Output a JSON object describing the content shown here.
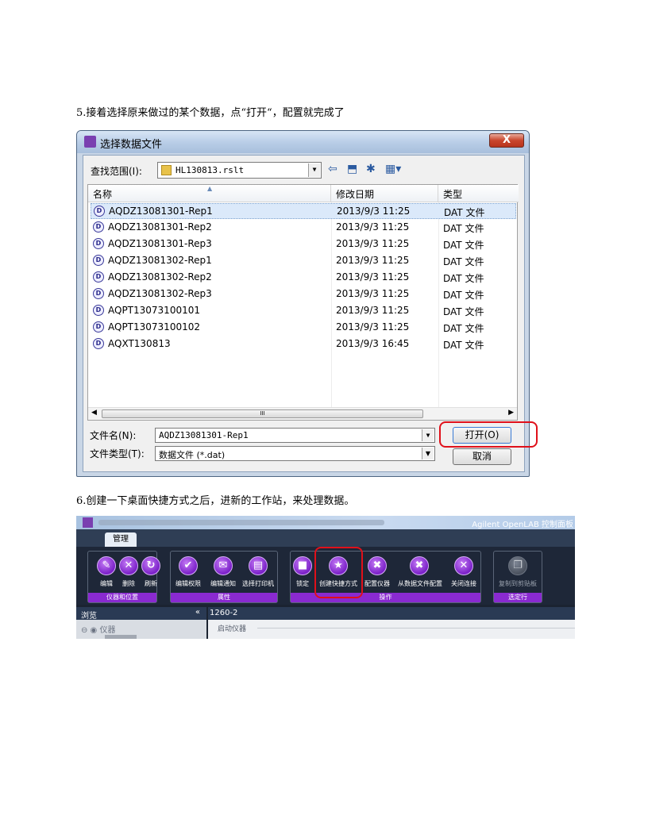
{
  "step5": "5.接着选择原来做过的某个数据，点“打开“，配置就完成了",
  "step6": "6.创建一下桌面快捷方式之后，进新的工作站，来处理数据。",
  "dialog": {
    "title": "选择数据文件",
    "close": "X",
    "lookin_label": "查找范围(I):",
    "lookin_value": "HL130813.rslt",
    "columns": [
      "名称",
      "修改日期",
      "类型"
    ],
    "files": [
      {
        "name": "AQDZ13081301-Rep1",
        "date": "2013/9/3 11:25",
        "type": "DAT 文件"
      },
      {
        "name": "AQDZ13081301-Rep2",
        "date": "2013/9/3 11:25",
        "type": "DAT 文件"
      },
      {
        "name": "AQDZ13081301-Rep3",
        "date": "2013/9/3 11:25",
        "type": "DAT 文件"
      },
      {
        "name": "AQDZ13081302-Rep1",
        "date": "2013/9/3 11:25",
        "type": "DAT 文件"
      },
      {
        "name": "AQDZ13081302-Rep2",
        "date": "2013/9/3 11:25",
        "type": "DAT 文件"
      },
      {
        "name": "AQDZ13081302-Rep3",
        "date": "2013/9/3 11:25",
        "type": "DAT 文件"
      },
      {
        "name": "AQPT13073100101",
        "date": "2013/9/3 11:25",
        "type": "DAT 文件"
      },
      {
        "name": "AQPT13073100102",
        "date": "2013/9/3 11:25",
        "type": "DAT 文件"
      },
      {
        "name": "AQXT130813",
        "date": "2013/9/3 16:45",
        "type": "DAT 文件"
      }
    ],
    "filename_label": "文件名(N):",
    "filename_value": "AQDZ13081301-Rep1",
    "filetype_label": "文件类型(T):",
    "filetype_value": "数据文件 (*.dat)",
    "open_btn": "打开(O)",
    "cancel_btn": "取消",
    "scroll_grip": "III"
  },
  "openlab": {
    "brand": "Agilent OpenLAB 控制面板",
    "tab": "管理",
    "groups": [
      {
        "label": "仪器和位置",
        "buttons": [
          {
            "icon": "pencil-icon",
            "label": "编辑"
          },
          {
            "icon": "delete-icon",
            "label": "删除"
          },
          {
            "icon": "refresh-icon",
            "label": "刷新"
          }
        ]
      },
      {
        "label": "属性",
        "buttons": [
          {
            "icon": "shield-icon",
            "label": "编辑权限"
          },
          {
            "icon": "mail-icon",
            "label": "编辑通知"
          },
          {
            "icon": "printer-icon",
            "label": "选择打印机"
          }
        ]
      },
      {
        "label": "操作",
        "buttons": [
          {
            "icon": "lock-icon",
            "label": "锁定"
          },
          {
            "icon": "star-icon",
            "label": "创建快捷方式"
          },
          {
            "icon": "tools-icon",
            "label": "配置仪器"
          },
          {
            "icon": "tools-icon",
            "label": "从数据文件配置"
          },
          {
            "icon": "close-icon",
            "label": "关闭连接"
          }
        ]
      },
      {
        "label": "选定行",
        "buttons": [
          {
            "icon": "clipboard-icon",
            "label": "复制到剪贴板"
          }
        ]
      }
    ],
    "nav_header": "浏览",
    "nav_collapse": "«",
    "nav_item": "仪器",
    "main_header": "1260-2",
    "main_sub": "启动仪器"
  }
}
